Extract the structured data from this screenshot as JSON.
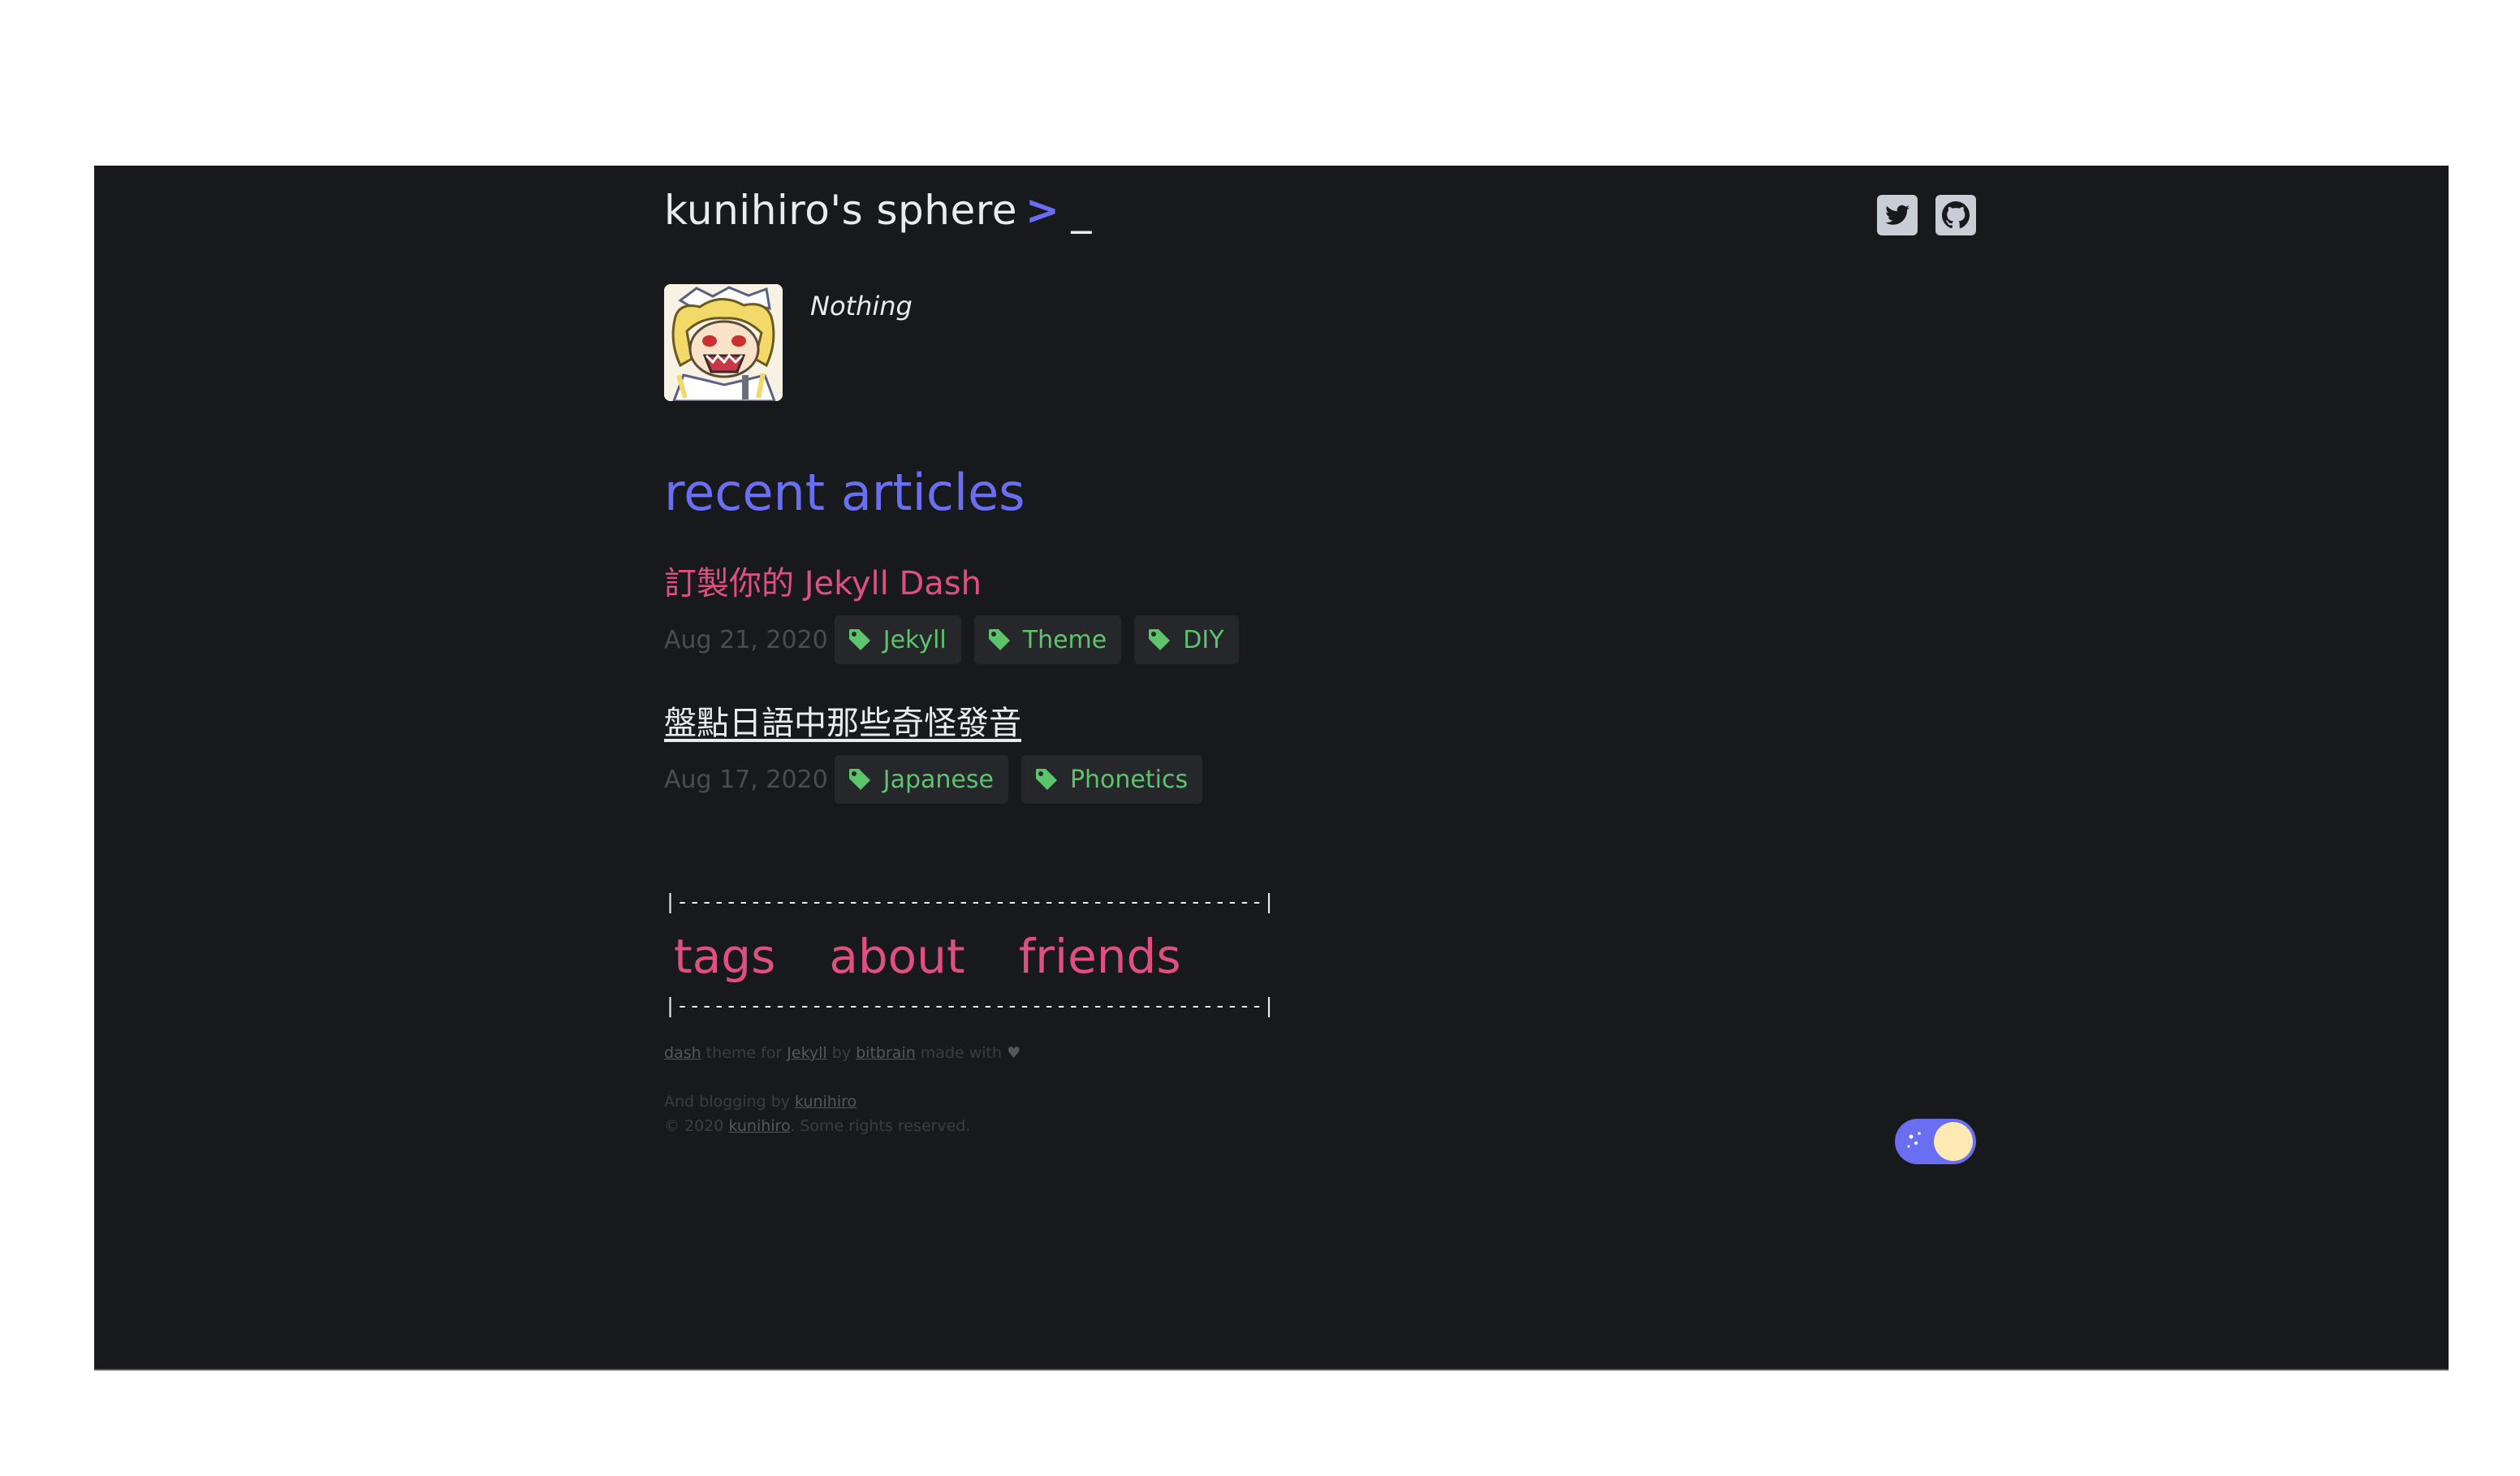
{
  "header": {
    "site_title": "kunihiro's sphere",
    "prompt_symbol": ">",
    "cursor_symbol": "_",
    "social_icons": [
      "twitter-icon",
      "github-icon"
    ]
  },
  "intro": {
    "bio": "Nothing"
  },
  "recent": {
    "heading": "recent articles",
    "posts": [
      {
        "title": "訂製你的 Jekyll Dash",
        "date": "Aug 21, 2020",
        "tags": [
          "Jekyll",
          "Theme",
          "DIY"
        ]
      },
      {
        "title": "盤點日語中那些奇怪發音",
        "date": "Aug 17, 2020",
        "tags": [
          "Japanese",
          "Phonetics"
        ]
      }
    ]
  },
  "footer": {
    "rule": "|------------------------------------------------|",
    "nav": [
      "tags",
      "about",
      "friends"
    ],
    "credit_line": {
      "dash": "dash",
      "theme_for": "theme for",
      "jekyll": "Jekyll",
      "by": "by",
      "bitbrain": "bitbrain",
      "made_with": "made with"
    },
    "blog_line": {
      "text": "And blogging by",
      "author": "kunihiro"
    },
    "copyright_line": {
      "prefix": "© 2020",
      "author": "kunihiro",
      "suffix": ". Some rights reserved."
    }
  },
  "colors": {
    "background": "#18191c",
    "accent_blue": "#6a6ff2",
    "accent_pink": "#e0507f",
    "tag_green": "#5dc46c",
    "tag_bg": "#25272b"
  }
}
